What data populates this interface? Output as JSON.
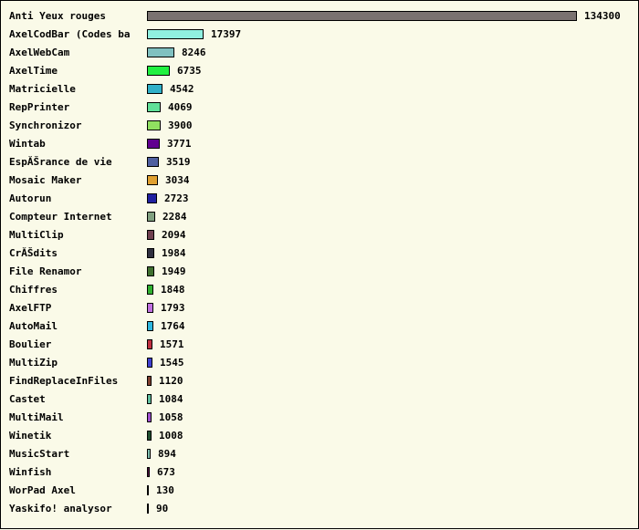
{
  "chart_data": {
    "type": "bar",
    "orientation": "horizontal",
    "categories": [
      "Anti Yeux rouges",
      "AxelCodBar (Codes ba",
      "AxelWebCam",
      "AxelTime",
      "Matricielle",
      "RepPrinter",
      "Synchronizor",
      "Wintab",
      "EspĂŠrance de vie",
      "Mosaic Maker",
      "Autorun",
      "Compteur Internet",
      "MultiClip",
      "CrĂŠdits",
      "File Renamor",
      "Chiffres",
      "AxelFTP",
      "AutoMail",
      "Boulier",
      "MultiZip",
      "FindReplaceInFiles",
      "Castet",
      "MultiMail",
      "Winetik",
      "MusicStart",
      "Winfish",
      "WorPad Axel",
      "Yaskifo! analysor"
    ],
    "values": [
      134300,
      17397,
      8246,
      6735,
      4542,
      4069,
      3900,
      3771,
      3519,
      3034,
      2723,
      2284,
      2094,
      1984,
      1949,
      1848,
      1793,
      1764,
      1571,
      1545,
      1120,
      1084,
      1058,
      1008,
      894,
      673,
      130,
      90
    ],
    "colors": [
      "#7a7270",
      "#90f0e0",
      "#80c0c0",
      "#20f040",
      "#30b0c8",
      "#60e098",
      "#90e060",
      "#600090",
      "#5060a0",
      "#e0a030",
      "#2020a0",
      "#80a080",
      "#704050",
      "#303040",
      "#407030",
      "#30b030",
      "#c070e0",
      "#30b8e0",
      "#c03040",
      "#4040d0",
      "#804030",
      "#60c0a0",
      "#a050d0",
      "#205030",
      "#80c0b0",
      "#501040",
      "#707070",
      "#707070"
    ],
    "xlim": [
      0,
      134300
    ],
    "grid": false,
    "legend": "none"
  }
}
